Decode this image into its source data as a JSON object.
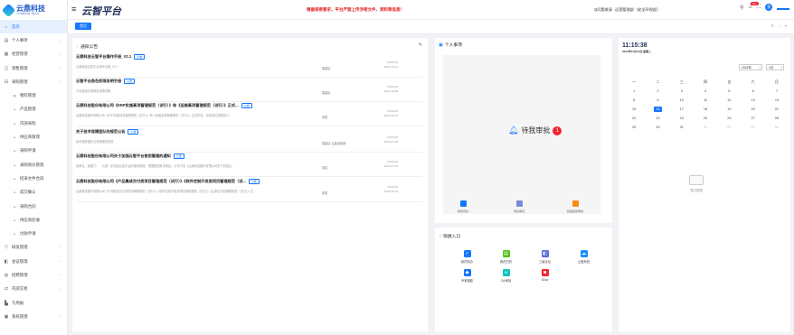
{
  "logo": {
    "cn": "云鼎科技",
    "en": "YUNDING TECH"
  },
  "sidebar": {
    "items": [
      {
        "label": "首页",
        "icon": "home-icon",
        "glyph": "⌂",
        "active": true,
        "sub": false,
        "chevron": false
      },
      {
        "label": "个人事项",
        "icon": "calendar-icon",
        "glyph": "▤",
        "sub": false,
        "chevron": true
      },
      {
        "label": "经营管理",
        "icon": "grid-icon",
        "glyph": "▦",
        "sub": false,
        "chevron": true
      },
      {
        "label": "销售管理",
        "icon": "cart-icon",
        "glyph": "◫",
        "sub": false,
        "chevron": true
      },
      {
        "label": "采购管理",
        "icon": "truck-icon",
        "glyph": "⊟",
        "sub": false,
        "chevron": true
      },
      {
        "label": "物料管理",
        "icon": "box-icon",
        "glyph": "▥",
        "sub": true,
        "chevron": false
      },
      {
        "label": "产品管理",
        "icon": "dot-icon",
        "glyph": "●",
        "sub": true,
        "chevron": false
      },
      {
        "label": "内部采购",
        "icon": "dot-icon",
        "glyph": "●",
        "sub": true,
        "chevron": false
      },
      {
        "label": "供应商管理",
        "icon": "dot-icon",
        "glyph": "●",
        "sub": true,
        "chevron": false
      },
      {
        "label": "采购申请",
        "icon": "dot-icon",
        "glyph": "●",
        "sub": true,
        "chevron": false
      },
      {
        "label": "采购询价管理",
        "icon": "dot-icon",
        "glyph": "●",
        "sub": true,
        "chevron": false
      },
      {
        "label": "招采文件合同",
        "icon": "dot-icon",
        "glyph": "●",
        "sub": true,
        "chevron": false
      },
      {
        "label": "成交确认",
        "icon": "dot-icon",
        "glyph": "●",
        "sub": true,
        "chevron": false
      },
      {
        "label": "采购合同",
        "icon": "dot-icon",
        "glyph": "●",
        "sub": true,
        "chevron": false
      },
      {
        "label": "供应商验收",
        "icon": "dot-icon",
        "glyph": "●",
        "sub": true,
        "chevron": false
      },
      {
        "label": "付款申请",
        "icon": "dot-icon",
        "glyph": "●",
        "sub": true,
        "chevron": false
      },
      {
        "label": "研发管理",
        "icon": "filter-icon",
        "glyph": "▽",
        "sub": false,
        "chevron": true
      },
      {
        "label": "会议管理",
        "icon": "meeting-icon",
        "glyph": "◧",
        "sub": false,
        "chevron": true
      },
      {
        "label": "招聘管理",
        "icon": "people-icon",
        "glyph": "◍",
        "sub": false,
        "chevron": true
      },
      {
        "label": "内部交易",
        "icon": "exchange-icon",
        "glyph": "⇄",
        "sub": false,
        "chevron": true
      },
      {
        "label": "写周报",
        "icon": "chart-icon",
        "glyph": "▙",
        "sub": false,
        "chevron": false
      },
      {
        "label": "系统管理",
        "icon": "settings-icon",
        "glyph": "▣",
        "sub": false,
        "chevron": true
      }
    ]
  },
  "header": {
    "title": "云智平台",
    "notice": "根据保密要求，平台严禁上传涉密文件、资料等信息！",
    "links": [
      "Q问题收录",
      "运营管理部（安全环保部）"
    ],
    "badge": "99+",
    "avatar_text": "我"
  },
  "tabs": [
    {
      "label": "首页"
    }
  ],
  "notices": {
    "title": "通知公告",
    "items": [
      {
        "title": "云鼎科技云智平台操作手册_V2.1",
        "tag": "公告",
        "desc": "云鼎科技云智平台操作手册_V2.1",
        "dept": "智能区",
        "date": "00:00:00",
        "date2": "2023-10-31"
      },
      {
        "title": "云智平台角色权限说明手册",
        "tag": "公告",
        "desc": "平台使用手册角色权限说明",
        "dept": "智能区",
        "date": "00:00:00",
        "date2": "2023-12-08"
      },
      {
        "title": "云鼎科技股份有限公司《ERP实施高项管理规范（试行）》和《运维高项管理规范（试行）》正式...",
        "tag": "公告",
        "desc": "云鼎科技股份有限公司《ERP实施高项管理规范（试行）》和《运维高项管理规范（试行）》正式印发，请各单位遵照执行。",
        "dept": "综发",
        "date": "00:00:00",
        "date2": "2023-06-29"
      },
      {
        "title": "关于技术保障团队的规范公告",
        "tag": "公告",
        "desc": "技术保障团队日常管理及规范",
        "dept": "智能区 云鼎运营部",
        "date": "00:00:00",
        "date2": "2023-07-28"
      },
      {
        "title": "云鼎科技股份有限公司关于加强云智平台使用管理的通知",
        "tag": "公告",
        "desc": "各单位、各部门：　为进一步加强云智平台的使用管理，根据集团有关规定，公司下发《云鼎科技股份有限公司关于加强云...",
        "dept": "综发",
        "date": "00:00:00",
        "date2": "2023-07-19"
      },
      {
        "title": "云鼎科技股份有限公司《产品集成交付类项目管理规范（试行）》《软件定制开发类项目管理规范（试...",
        "tag": "公告",
        "desc": "云鼎科技股份有限公司《产品集成交付类项目管理规范（试行）》《软件定制开发类项目管理规范（试行）》《云原生项目管理规范（试行）》正...",
        "dept": "综发",
        "date": "00:00:00",
        "date2": "2023-06-20"
      }
    ]
  },
  "personal": {
    "title": "个人事项",
    "pending_label": "待我审批",
    "pending_count": "1",
    "mini": [
      {
        "label": "我的待办",
        "color": "#1677ff"
      },
      {
        "label": "待办审批",
        "color": "#7b8ad8"
      },
      {
        "label": "我发起的审批",
        "color": "#fa8c16"
      }
    ]
  },
  "quick": {
    "title": "快捷入口",
    "items": [
      {
        "label": "我的待办",
        "color": "#1677ff",
        "glyph": "✓"
      },
      {
        "label": "我的日历",
        "color": "#52c41a",
        "glyph": "▤"
      },
      {
        "label": "三级论坛",
        "color": "#5b6bd8",
        "glyph": "◧"
      },
      {
        "label": "云盘系统",
        "color": "#1890ff",
        "glyph": "☁"
      },
      {
        "label": "专家抽取",
        "color": "#1677ff",
        "glyph": "◆"
      },
      {
        "label": "OA审批",
        "color": "#13c2c2",
        "glyph": "∞"
      },
      {
        "label": "Glow",
        "color": "#f5222d",
        "glyph": "◙"
      }
    ]
  },
  "calendar": {
    "time": "11:15:38",
    "date": "2024年01月16日 星期二",
    "year": "2024年",
    "month": "1月",
    "weekdays": [
      "一",
      "二",
      "三",
      "四",
      "五",
      "六",
      "日"
    ],
    "days": [
      {
        "d": "1",
        "o": false
      },
      {
        "d": "2",
        "o": false
      },
      {
        "d": "3",
        "o": false
      },
      {
        "d": "4",
        "o": false
      },
      {
        "d": "5",
        "o": false
      },
      {
        "d": "6",
        "o": false
      },
      {
        "d": "7",
        "o": false
      },
      {
        "d": "8",
        "o": false
      },
      {
        "d": "9",
        "o": false
      },
      {
        "d": "10",
        "o": false
      },
      {
        "d": "11",
        "o": false
      },
      {
        "d": "12",
        "o": false
      },
      {
        "d": "13",
        "o": false
      },
      {
        "d": "14",
        "o": false
      },
      {
        "d": "15",
        "o": false
      },
      {
        "d": "16",
        "o": false,
        "today": true
      },
      {
        "d": "17",
        "o": false
      },
      {
        "d": "18",
        "o": false
      },
      {
        "d": "19",
        "o": false
      },
      {
        "d": "20",
        "o": false
      },
      {
        "d": "21",
        "o": false
      },
      {
        "d": "22",
        "o": false
      },
      {
        "d": "23",
        "o": false
      },
      {
        "d": "24",
        "o": false
      },
      {
        "d": "25",
        "o": false
      },
      {
        "d": "26",
        "o": false
      },
      {
        "d": "27",
        "o": false
      },
      {
        "d": "28",
        "o": false
      },
      {
        "d": "29",
        "o": false
      },
      {
        "d": "30",
        "o": false
      },
      {
        "d": "31",
        "o": false
      },
      {
        "d": "01",
        "o": true
      },
      {
        "d": "02",
        "o": true
      },
      {
        "d": "03",
        "o": true
      },
      {
        "d": "04",
        "o": true
      }
    ],
    "empty_label": "暂无数据"
  }
}
